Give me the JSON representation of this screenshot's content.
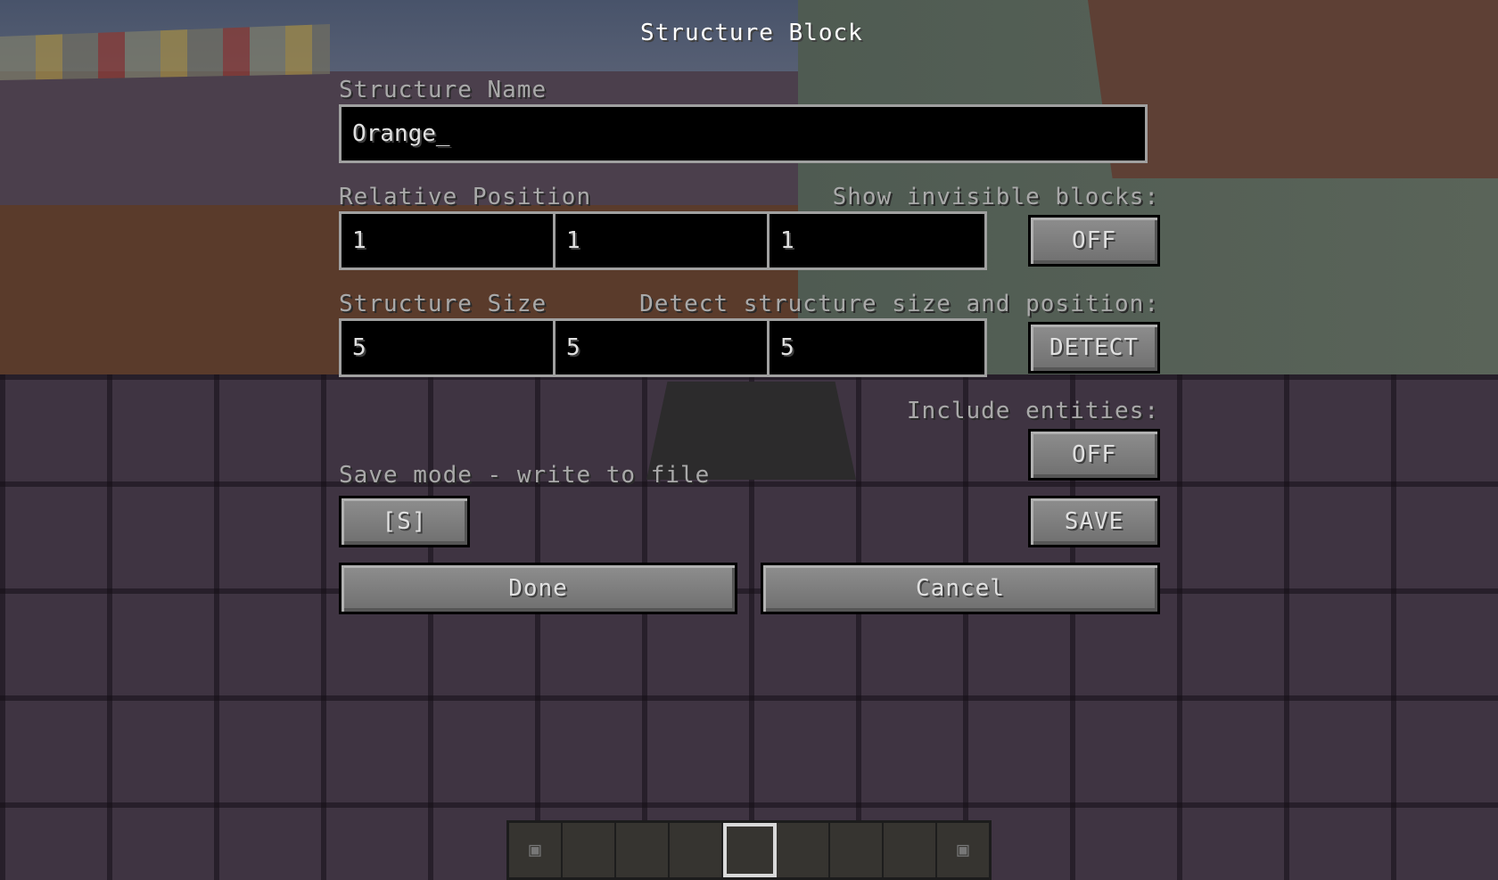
{
  "screen": {
    "title": "Structure Block"
  },
  "structure_name": {
    "label": "Structure Name",
    "value": "Orange_"
  },
  "relative_position": {
    "label": "Relative Position",
    "x": "1",
    "y": "1",
    "z": "1"
  },
  "show_invisible": {
    "label": "Show invisible blocks:",
    "button": "OFF"
  },
  "structure_size": {
    "label": "Structure Size",
    "x": "5",
    "y": "5",
    "z": "5"
  },
  "detect": {
    "label": "Detect structure size and position:",
    "button": "DETECT"
  },
  "include_entities": {
    "label": "Include entities:",
    "button": "OFF"
  },
  "mode": {
    "description": "Save mode - write to file",
    "button": "[S]"
  },
  "actions": {
    "save": "SAVE",
    "done": "Done",
    "cancel": "Cancel"
  },
  "hotbar": {
    "slot_count": 9,
    "selected_slot": 5,
    "slots": [
      "structure-block-icon",
      "",
      "",
      "",
      "",
      "",
      "",
      "",
      "structure-block-icon"
    ]
  },
  "colors": {
    "text": "#e0e0e0",
    "muted_label": "#a9a9a9",
    "field_background": "#000000",
    "field_border": "#a0a0a0",
    "button_face": "#7d7d7d"
  }
}
